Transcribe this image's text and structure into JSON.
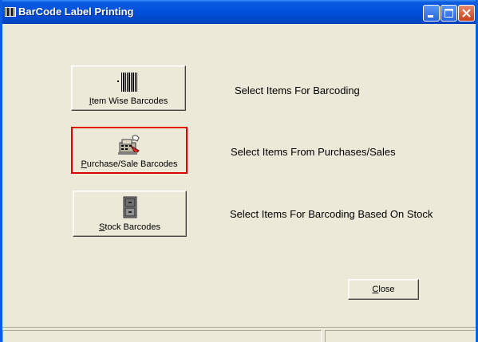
{
  "window": {
    "title": "BarCode Label Printing"
  },
  "buttons": {
    "item_wise": {
      "accel": "I",
      "rest": "tem Wise Barcodes"
    },
    "purchase_sale": {
      "accel": "P",
      "rest": "urchase/Sale Barcodes"
    },
    "stock": {
      "accel": "S",
      "rest": "tock Barcodes"
    },
    "close": {
      "accel": "C",
      "rest": "lose"
    }
  },
  "descriptions": {
    "item_wise": "Select Items For Barcoding",
    "purchase_sale": "Select Items From Purchases/Sales",
    "stock": "Select Items For Barcoding Based On Stock"
  },
  "icons": {
    "app": "barcode-icon",
    "item_wise": "barcode-icon",
    "purchase_sale": "cash-register-icon",
    "stock": "file-cabinet-icon"
  },
  "colors": {
    "titlebar": "#0050DC",
    "window_bg": "#ECE9D8",
    "focus_border": "#E00000"
  }
}
